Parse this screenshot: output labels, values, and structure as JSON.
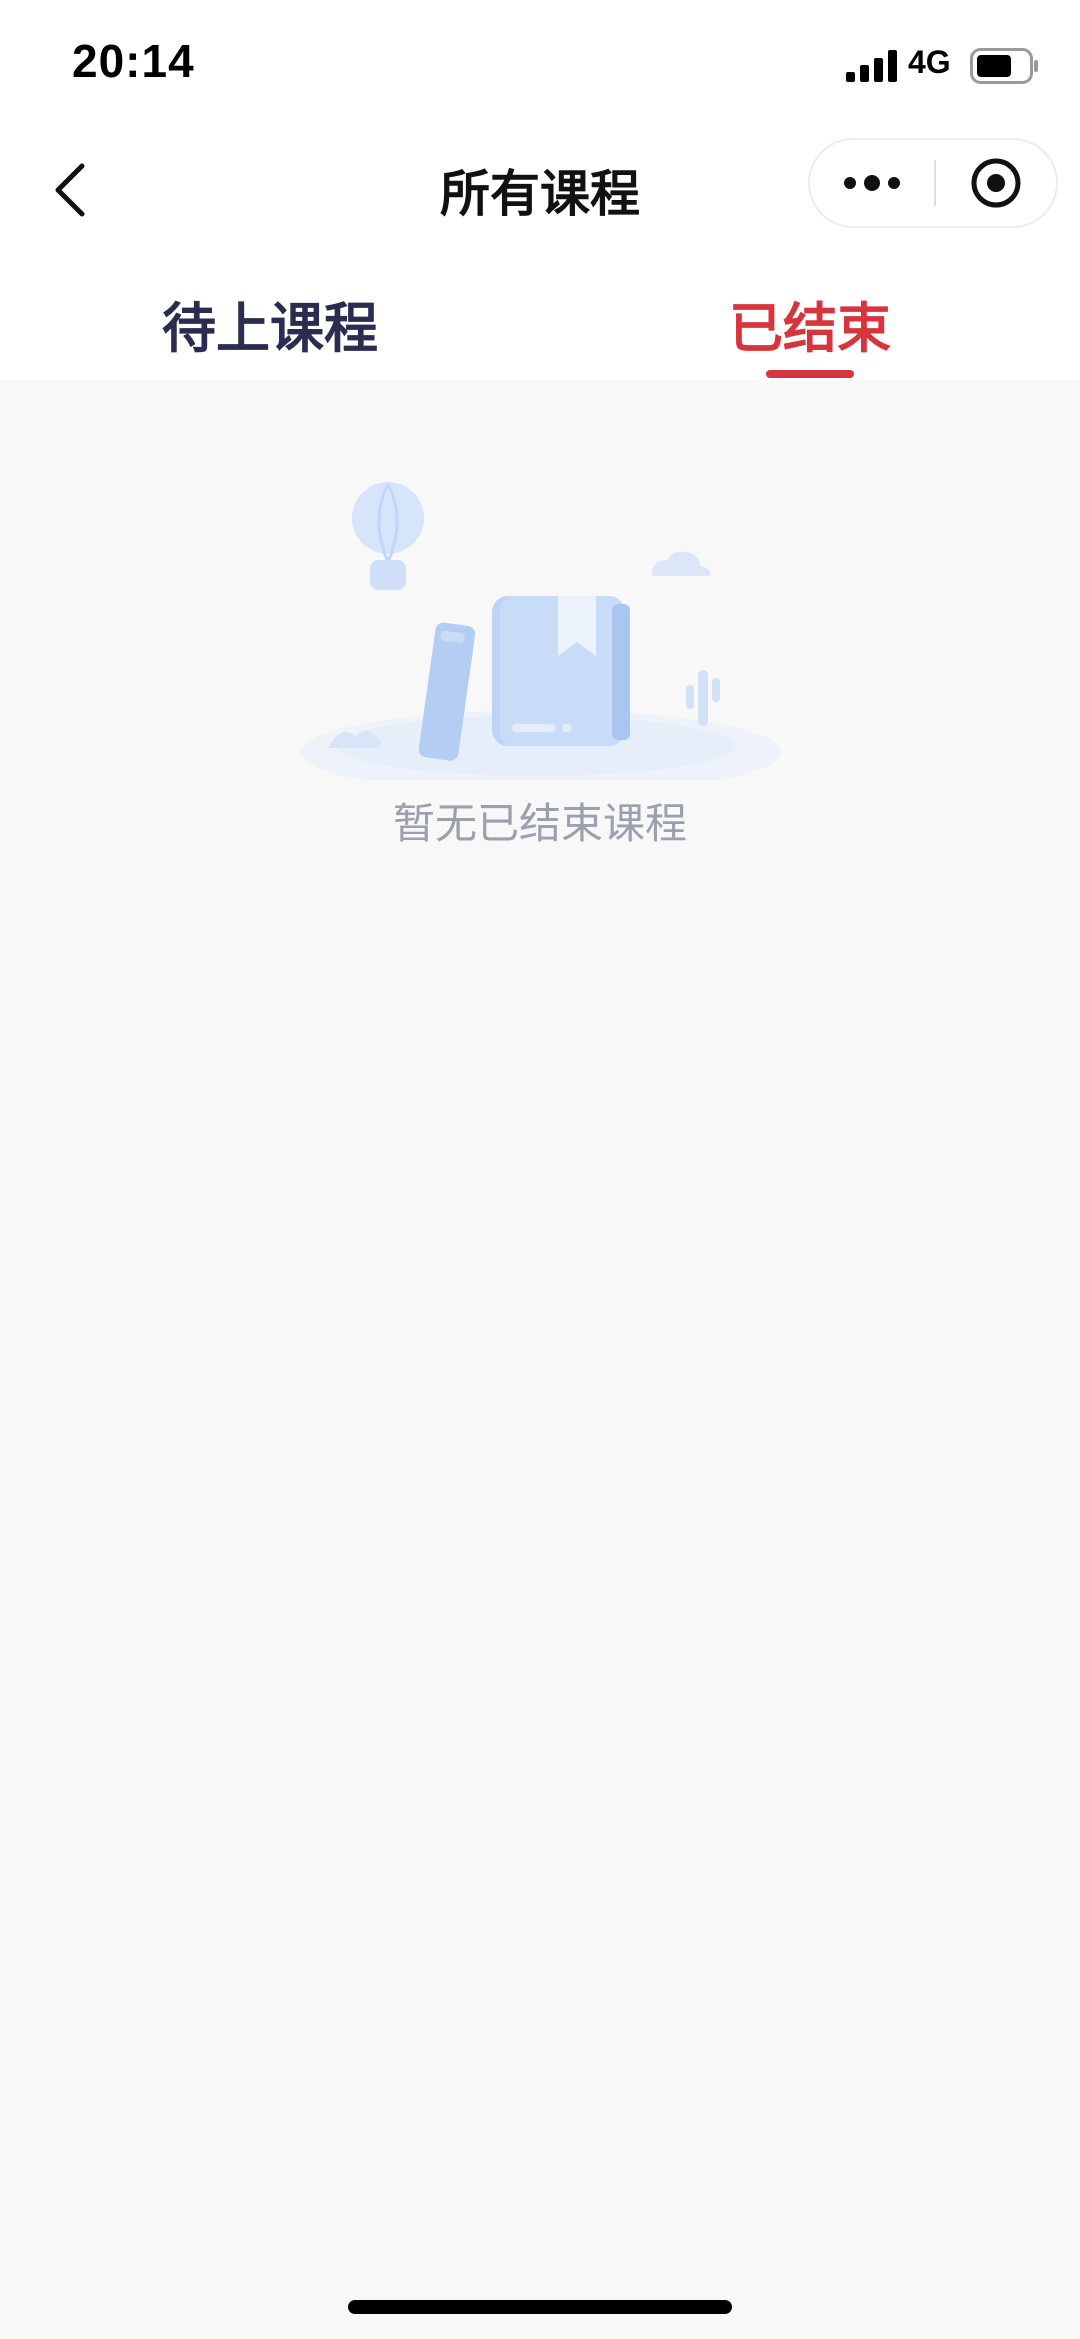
{
  "status_bar": {
    "time": "20:14",
    "network": "4G",
    "signal_icon": "signal-bars-icon",
    "battery_icon": "battery-icon",
    "battery_level": 0.7
  },
  "nav": {
    "title": "所有课程",
    "back_icon": "chevron-left-icon",
    "more_icon": "more-dots-icon",
    "close_icon": "target-close-icon"
  },
  "tabs": [
    {
      "label": "待上课程",
      "active": false
    },
    {
      "label": "已结束",
      "active": true
    }
  ],
  "colors": {
    "accent": "#d8343c",
    "tab_inactive": "#2a2d4f",
    "background": "#f8f8f8",
    "empty_text": "#9aa0ad",
    "illustration_blue": "#c9dcf7"
  },
  "empty_state": {
    "illustration_icon": "empty-book-illustration",
    "message": "暂无已结束课程"
  }
}
